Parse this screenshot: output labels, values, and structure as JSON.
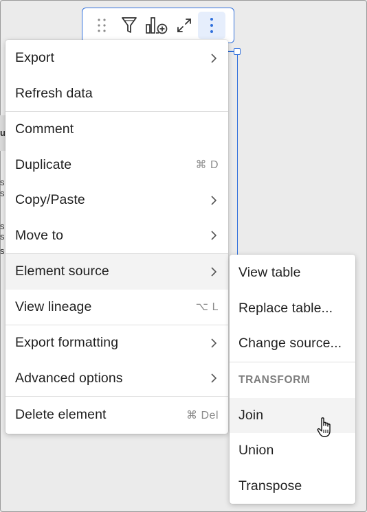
{
  "background": {
    "fragments": [
      "u",
      "s",
      "s",
      "s",
      "s",
      "s"
    ]
  },
  "toolbar": {
    "buttons": [
      {
        "icon": "drag-handle-icon"
      },
      {
        "icon": "filter-icon"
      },
      {
        "icon": "add-chart-icon"
      },
      {
        "icon": "expand-icon"
      },
      {
        "icon": "more-vertical-icon"
      }
    ]
  },
  "menu": {
    "items": [
      {
        "label": "Export",
        "submenu": true
      },
      {
        "label": "Refresh data"
      },
      {
        "label": "Comment"
      },
      {
        "label": "Duplicate",
        "shortcut": "⌘ D"
      },
      {
        "label": "Copy/Paste",
        "submenu": true
      },
      {
        "label": "Move to",
        "submenu": true
      },
      {
        "label": "Element source",
        "submenu": true,
        "highlighted": true
      },
      {
        "label": "View lineage",
        "shortcut": "⌥ L"
      },
      {
        "label": "Export formatting",
        "submenu": true
      },
      {
        "label": "Advanced options",
        "submenu": true
      },
      {
        "label": "Delete element",
        "shortcut": "⌘ Del"
      }
    ]
  },
  "submenu": {
    "items": [
      {
        "label": "View table"
      },
      {
        "label": "Replace table..."
      },
      {
        "label": "Change source..."
      }
    ],
    "section_title": "TRANSFORM",
    "transform_items": [
      {
        "label": "Join",
        "hovered": true
      },
      {
        "label": "Union"
      },
      {
        "label": "Transpose"
      }
    ]
  },
  "colors": {
    "accent": "#2f6fdc",
    "menu_bg": "#ffffff",
    "hover_bg": "#f3f3f3",
    "muted_text": "#8a8a8a"
  }
}
